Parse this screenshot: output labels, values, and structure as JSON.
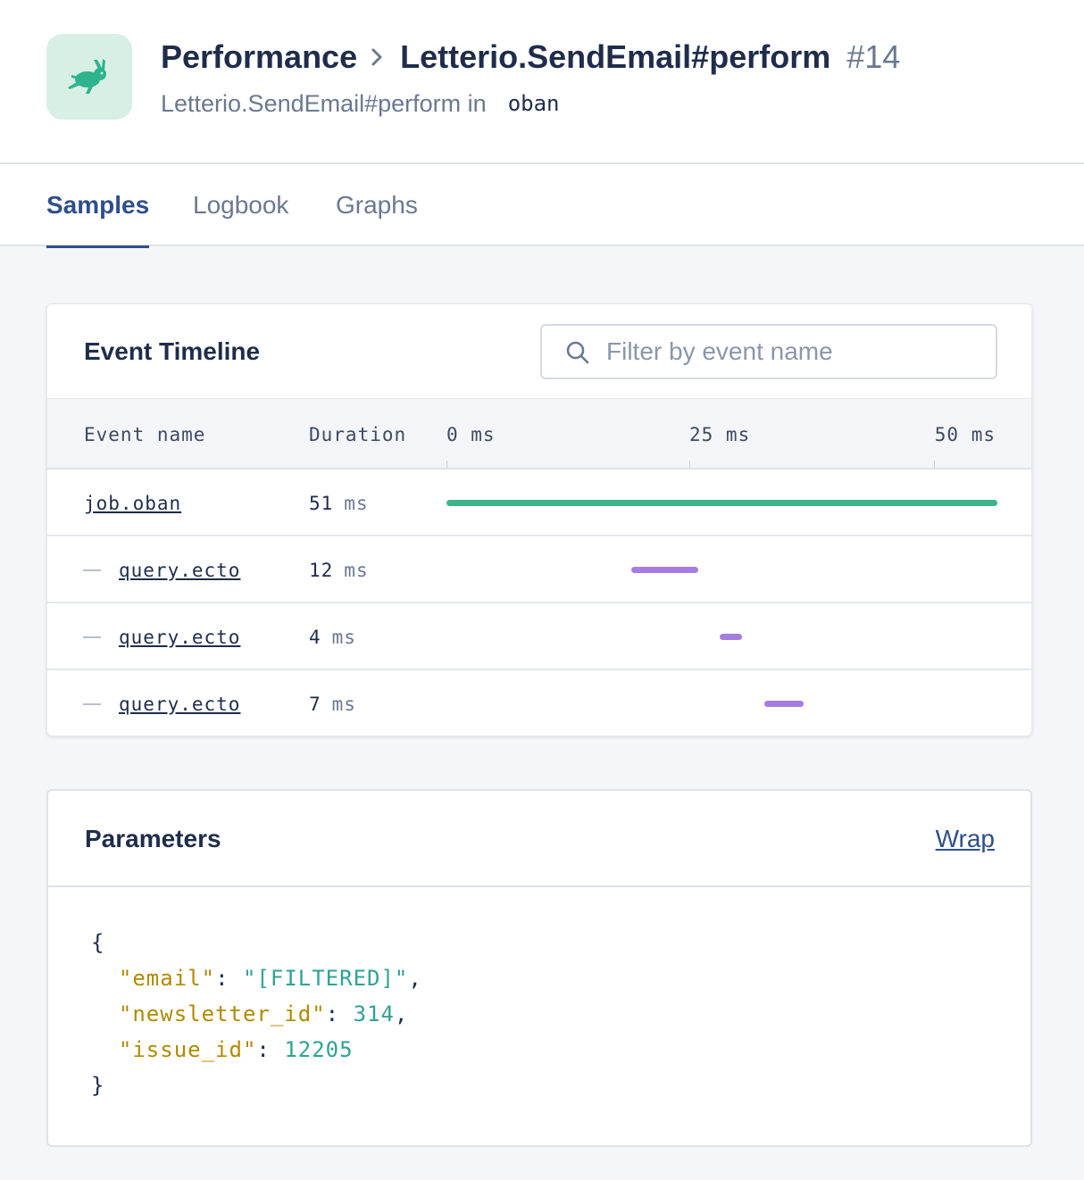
{
  "header": {
    "breadcrumb_root": "Performance",
    "breadcrumb_current": "Letterio.SendEmail#perform",
    "sample_number": "#14",
    "subtitle": "Letterio.SendEmail#perform in",
    "namespace": "oban"
  },
  "tabs": [
    {
      "label": "Samples",
      "active": true
    },
    {
      "label": "Logbook",
      "active": false
    },
    {
      "label": "Graphs",
      "active": false
    }
  ],
  "timeline": {
    "title": "Event Timeline",
    "search_placeholder": "Filter by event name",
    "columns": {
      "event_name": "Event name",
      "duration": "Duration",
      "ticks": [
        "0 ms",
        "25 ms",
        "50 ms"
      ]
    },
    "axis_max_ms": 51,
    "rows": [
      {
        "name": "job.oban",
        "duration": "51",
        "unit": "ms",
        "start_ms": 0,
        "length_ms": 51,
        "child": false,
        "color": "#3db389"
      },
      {
        "name": "query.ecto",
        "duration": "12",
        "unit": "ms",
        "start_ms": 17.1,
        "length_ms": 6.2,
        "child": true,
        "color": "#a57ddf"
      },
      {
        "name": "query.ecto",
        "duration": "4",
        "unit": "ms",
        "start_ms": 25.3,
        "length_ms": 2.1,
        "child": true,
        "color": "#a57ddf"
      },
      {
        "name": "query.ecto",
        "duration": "7",
        "unit": "ms",
        "start_ms": 29.4,
        "length_ms": 3.7,
        "child": true,
        "color": "#a57ddf"
      }
    ]
  },
  "parameters": {
    "title": "Parameters",
    "wrap_label": "Wrap",
    "open_brace": "{",
    "close_brace": "}",
    "entries": [
      {
        "key": "\"email\"",
        "value": "\"[FILTERED]\"",
        "trail": ","
      },
      {
        "key": "\"newsletter_id\"",
        "value": "314",
        "trail": ","
      },
      {
        "key": "\"issue_id\"",
        "value": "12205",
        "trail": ""
      }
    ]
  },
  "colors": {
    "primary": "#2f4f8a",
    "bar_root": "#3db389",
    "bar_child": "#a57ddf",
    "json_key": "#b08a00",
    "json_value": "#2fa394"
  }
}
